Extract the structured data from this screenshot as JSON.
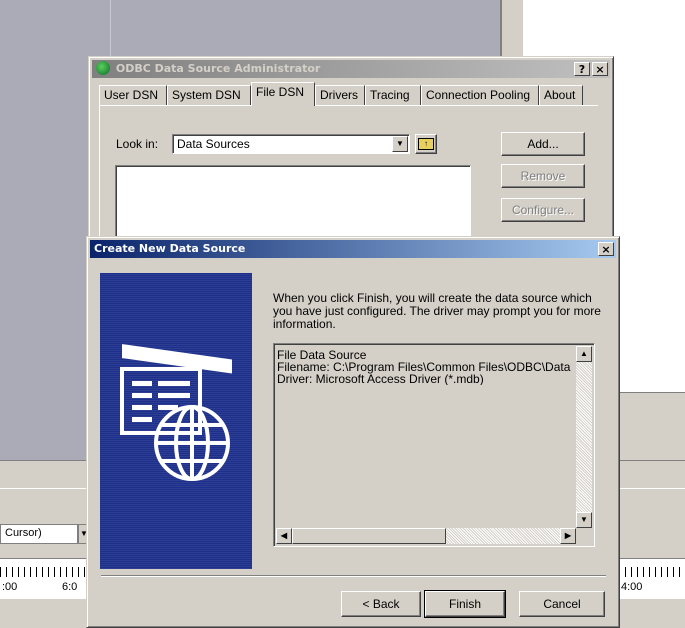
{
  "background": {
    "combo_value": "Cursor)",
    "ruler_left_labels": [
      ":00",
      "6:0"
    ],
    "ruler_right_label": "4:00"
  },
  "odbc": {
    "title": "ODBC Data Source Administrator",
    "help_button": "?",
    "close_button": "×",
    "tabs": [
      "User DSN",
      "System DSN",
      "File DSN",
      "Drivers",
      "Tracing",
      "Connection Pooling",
      "About"
    ],
    "selected_tab": "File DSN",
    "look_in_label": "Look in:",
    "look_in_value": "Data Sources",
    "buttons": {
      "add": "Add...",
      "remove": "Remove",
      "configure": "Configure..."
    }
  },
  "wizard": {
    "title": "Create New Data Source",
    "close_button": "×",
    "description": "When you click Finish, you will create the data source which you have just configured.  The driver may prompt you for more information.",
    "summary_lines": [
      "File Data Source",
      "Filename:  C:\\Program Files\\Common Files\\ODBC\\Data",
      "Driver:  Microsoft Access Driver (*.mdb)"
    ],
    "buttons": {
      "back": "< Back",
      "finish": "Finish",
      "cancel": "Cancel"
    }
  }
}
